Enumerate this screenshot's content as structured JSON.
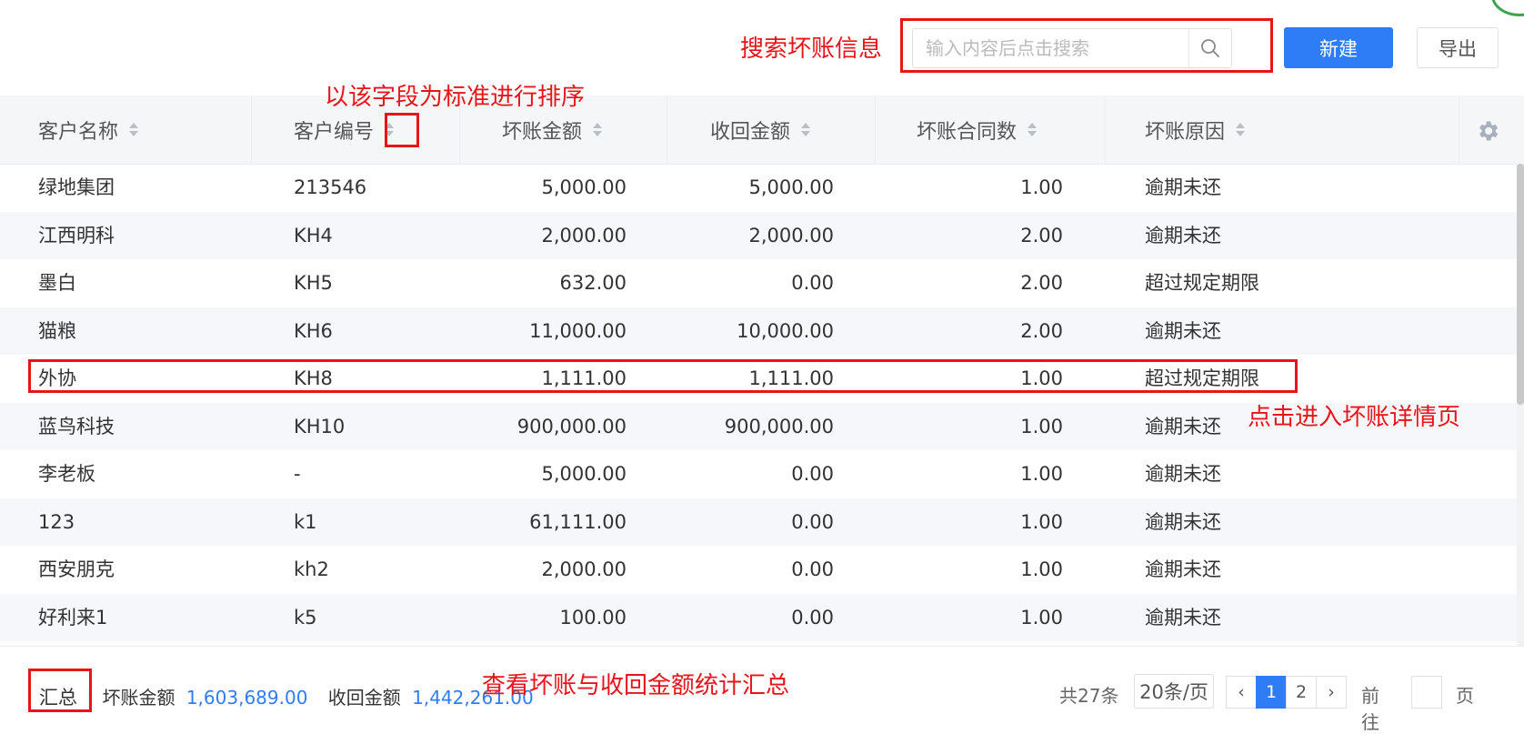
{
  "toolbar": {
    "search_placeholder": "输入内容后点击搜索",
    "search_value": "",
    "new_label": "新建",
    "export_label": "导出"
  },
  "table": {
    "columns": [
      {
        "key": "name",
        "label": "客户名称"
      },
      {
        "key": "code",
        "label": "客户编号"
      },
      {
        "key": "bad_amount",
        "label": "坏账金额"
      },
      {
        "key": "recovered_amount",
        "label": "收回金额"
      },
      {
        "key": "contract_count",
        "label": "坏账合同数"
      },
      {
        "key": "reason",
        "label": "坏账原因"
      }
    ],
    "rows": [
      {
        "name": "绿地集团",
        "code": "213546",
        "bad_amount": "5,000.00",
        "recovered_amount": "5,000.00",
        "contract_count": "1.00",
        "reason": "逾期未还"
      },
      {
        "name": "江西明科",
        "code": "KH4",
        "bad_amount": "2,000.00",
        "recovered_amount": "2,000.00",
        "contract_count": "2.00",
        "reason": "逾期未还"
      },
      {
        "name": "墨白",
        "code": "KH5",
        "bad_amount": "632.00",
        "recovered_amount": "0.00",
        "contract_count": "2.00",
        "reason": "超过规定期限"
      },
      {
        "name": "猫粮",
        "code": "KH6",
        "bad_amount": "11,000.00",
        "recovered_amount": "10,000.00",
        "contract_count": "2.00",
        "reason": "逾期未还"
      },
      {
        "name": "外协",
        "code": "KH8",
        "bad_amount": "1,111.00",
        "recovered_amount": "1,111.00",
        "contract_count": "1.00",
        "reason": "超过规定期限"
      },
      {
        "name": "蓝鸟科技",
        "code": "KH10",
        "bad_amount": "900,000.00",
        "recovered_amount": "900,000.00",
        "contract_count": "1.00",
        "reason": "逾期未还"
      },
      {
        "name": "李老板",
        "code": "-",
        "bad_amount": "5,000.00",
        "recovered_amount": "0.00",
        "contract_count": "1.00",
        "reason": "逾期未还"
      },
      {
        "name": "123",
        "code": "k1",
        "bad_amount": "61,111.00",
        "recovered_amount": "0.00",
        "contract_count": "1.00",
        "reason": "逾期未还"
      },
      {
        "name": "西安朋克",
        "code": "kh2",
        "bad_amount": "2,000.00",
        "recovered_amount": "0.00",
        "contract_count": "1.00",
        "reason": "逾期未还"
      },
      {
        "name": "好利来1",
        "code": "k5",
        "bad_amount": "100.00",
        "recovered_amount": "0.00",
        "contract_count": "1.00",
        "reason": "逾期未还"
      }
    ]
  },
  "summary": {
    "title": "汇总",
    "separator": "|",
    "bad_label": "坏账金额",
    "bad_value": "1,603,689.00",
    "recovered_label": "收回金额",
    "recovered_value": "1,442,261.00"
  },
  "pagination": {
    "total_text": "共27条",
    "page_size": "20条/页",
    "prev_icon": "‹",
    "next_icon": "›",
    "pages": [
      "1",
      "2"
    ],
    "current_page": "1",
    "goto_label": "前往",
    "page_suffix": "页"
  },
  "annotations": {
    "search": "搜索坏账信息",
    "sort": "以该字段为标准进行排序",
    "detail": "点击进入坏账详情页",
    "summary": "查看坏账与收回金额统计汇总"
  },
  "colors": {
    "accent": "#2f7df6",
    "annotation": "#e8141a",
    "header_bg": "#f5f6f8"
  }
}
